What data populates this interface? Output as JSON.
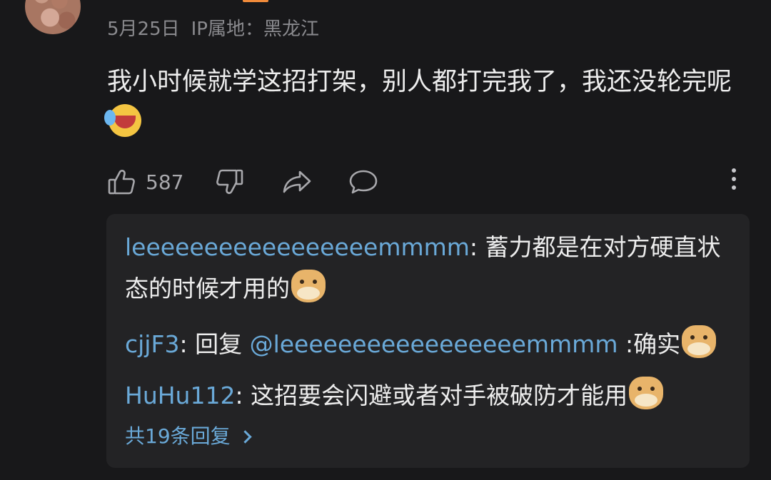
{
  "comment": {
    "date": "5月25日",
    "ip_location": "IP属地：黑龙江",
    "text": "我小时候就学这招打架，别人都打完我了，我还没轮完呢",
    "emoji": "laugh-cry-emoji",
    "like_count": "587"
  },
  "actions": {
    "like_icon": "thumbs-up-icon",
    "dislike_icon": "thumbs-down-icon",
    "share_icon": "share-icon",
    "reply_icon": "comment-icon",
    "more_icon": "more-vertical-icon"
  },
  "replies": [
    {
      "user": "leeeeeeeeeeeeeeeeemmmm",
      "separator": ": ",
      "text": "蓄力都是在对方硬直状态的时候才用的",
      "emoji": "doge-emoji"
    },
    {
      "user": "cjjF3",
      "separator": ": ",
      "prefix": "回复 ",
      "mention": "@leeeeeeeeeeeeeeeeemmmm",
      "text": " :确实",
      "emoji": "doge-emoji"
    },
    {
      "user": "HuHu112",
      "separator": ": ",
      "text": "这招要会闪避或者对手被破防才能用",
      "emoji": "doge-emoji"
    }
  ],
  "more_replies_label": "共19条回复",
  "colors": {
    "background": "#18181a",
    "reply_panel": "#232325",
    "link_blue": "#6aa9d8",
    "muted": "#8a8a8e"
  }
}
